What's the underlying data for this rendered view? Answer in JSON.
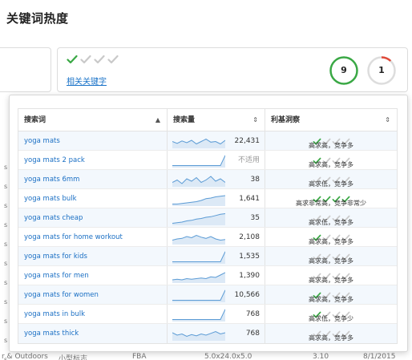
{
  "page_title": "关键词热度",
  "summary_card": {
    "related_link": "相关关键字",
    "checks_active": 1,
    "checks_total": 4,
    "ring_green": {
      "value": "9",
      "color": "#3aa845"
    },
    "ring_red": {
      "value": "1",
      "color": "#e04a3a",
      "fraction": 0.12
    }
  },
  "table": {
    "headers": {
      "keyword": "搜索词",
      "volume": "搜索量",
      "insight": "利基洞察"
    },
    "rows": [
      {
        "keyword": "yoga mats",
        "volume": "22,431",
        "checks": 1,
        "insight": "高求高，竞争多",
        "trend": [
          0.5,
          0.35,
          0.55,
          0.4,
          0.6,
          0.3,
          0.5,
          0.7,
          0.45,
          0.5,
          0.3,
          0.6
        ]
      },
      {
        "keyword": "yoga mats 2 pack",
        "volume": "不适用",
        "checks": 1,
        "insight": "高求高，竞争多",
        "trend": [
          0.1,
          0.1,
          0.1,
          0.1,
          0.1,
          0.1,
          0.1,
          0.1,
          0.1,
          0.1,
          0.1,
          0.95
        ]
      },
      {
        "keyword": "yoga mats 6mm",
        "volume": "38",
        "checks": 0,
        "insight": "高求低，竞争多",
        "trend": [
          0.3,
          0.5,
          0.2,
          0.6,
          0.4,
          0.7,
          0.3,
          0.5,
          0.8,
          0.4,
          0.6,
          0.3
        ]
      },
      {
        "keyword": "yoga mats bulk",
        "volume": "1,641",
        "checks": 4,
        "insight": "高求非常高，竞争非常少",
        "trend": [
          0.1,
          0.1,
          0.15,
          0.2,
          0.25,
          0.3,
          0.4,
          0.55,
          0.6,
          0.7,
          0.75,
          0.8
        ]
      },
      {
        "keyword": "yoga mats cheap",
        "volume": "35",
        "checks": 0,
        "insight": "高求低，竞争多",
        "trend": [
          0.1,
          0.15,
          0.2,
          0.3,
          0.35,
          0.45,
          0.5,
          0.6,
          0.65,
          0.75,
          0.85,
          0.9
        ]
      },
      {
        "keyword": "yoga mats for home workout",
        "volume": "2,108",
        "checks": 1,
        "insight": "高求高，竞争多",
        "trend": [
          0.3,
          0.4,
          0.45,
          0.6,
          0.5,
          0.7,
          0.55,
          0.45,
          0.6,
          0.4,
          0.3,
          0.35
        ]
      },
      {
        "keyword": "yoga mats for kids",
        "volume": "1,535",
        "checks": 0,
        "insight": "高求高，竞争多",
        "trend": [
          0.1,
          0.1,
          0.1,
          0.1,
          0.1,
          0.1,
          0.1,
          0.1,
          0.1,
          0.1,
          0.1,
          0.95
        ]
      },
      {
        "keyword": "yoga mats for men",
        "volume": "1,390",
        "checks": 0,
        "insight": "高求高，竞争多",
        "trend": [
          0.2,
          0.25,
          0.2,
          0.3,
          0.25,
          0.3,
          0.35,
          0.3,
          0.45,
          0.4,
          0.6,
          0.8
        ]
      },
      {
        "keyword": "yoga mats for women",
        "volume": "10,566",
        "checks": 1,
        "insight": "高求高，竞争多",
        "trend": [
          0.1,
          0.1,
          0.1,
          0.1,
          0.1,
          0.1,
          0.1,
          0.1,
          0.1,
          0.1,
          0.1,
          0.95
        ]
      },
      {
        "keyword": "yoga mats in bulk",
        "volume": "768",
        "checks": 1,
        "insight": "高求低，竞争少",
        "trend": [
          0.1,
          0.1,
          0.1,
          0.1,
          0.1,
          0.1,
          0.1,
          0.1,
          0.1,
          0.1,
          0.1,
          0.95
        ]
      },
      {
        "keyword": "yoga mats thick",
        "volume": "768",
        "checks": 0,
        "insight": "高求高，竞争多",
        "trend": [
          0.6,
          0.4,
          0.5,
          0.3,
          0.45,
          0.35,
          0.5,
          0.4,
          0.55,
          0.7,
          0.5,
          0.6
        ]
      }
    ]
  },
  "background": {
    "bottom_row": [
      "r & Outdoors",
      "小型标志",
      "FBA",
      "5.0x24.0x5.0",
      "3.10",
      "8/1/2015"
    ],
    "side_marker": "s"
  },
  "colors": {
    "check_active": "#3aa845",
    "check_inactive": "#c9c9c9",
    "link": "#1a6fc4",
    "sparkline": "#5b9bd5",
    "sparkline_fill": "#dce9f6"
  }
}
